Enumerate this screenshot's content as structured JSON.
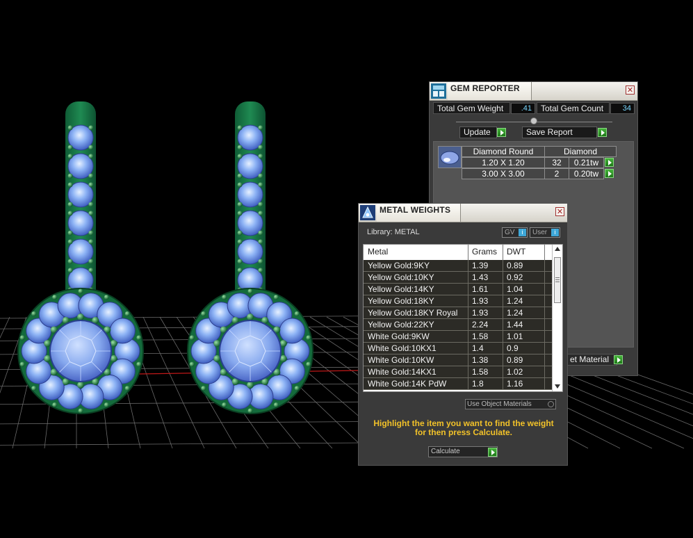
{
  "gem_reporter": {
    "title": "GEM REPORTER",
    "total_gem_weight_label": "Total Gem Weight",
    "total_gem_weight_value": ".41",
    "total_gem_count_label": "Total Gem Count",
    "total_gem_count_value": "34",
    "update_label": "Update",
    "save_report_label": "Save Report",
    "table": {
      "header_shape": "Diamond Round",
      "header_material": "Diamond",
      "rows": [
        {
          "size": "1.20 X 1.20",
          "count": "32",
          "weight": "0.21tw"
        },
        {
          "size": "3.00 X 3.00",
          "count": "2",
          "weight": "0.20tw"
        }
      ]
    },
    "object_material_label": "et Material"
  },
  "metal_weights": {
    "title": "METAL WEIGHTS",
    "library_label": "Library: METAL",
    "gv_label": "GV",
    "user_label": "User",
    "info_glyph": "i",
    "columns": [
      "Metal",
      "Grams",
      "DWT"
    ],
    "rows": [
      {
        "metal": "Yellow Gold:9KY",
        "grams": "1.39",
        "dwt": "0.89"
      },
      {
        "metal": "Yellow Gold:10KY",
        "grams": "1.43",
        "dwt": "0.92"
      },
      {
        "metal": "Yellow Gold:14KY",
        "grams": "1.61",
        "dwt": "1.04"
      },
      {
        "metal": "Yellow Gold:18KY",
        "grams": "1.93",
        "dwt": "1.24"
      },
      {
        "metal": "Yellow Gold:18KY Royal",
        "grams": "1.93",
        "dwt": "1.24"
      },
      {
        "metal": "Yellow Gold:22KY",
        "grams": "2.24",
        "dwt": "1.44"
      },
      {
        "metal": "White Gold:9KW",
        "grams": "1.58",
        "dwt": "1.01"
      },
      {
        "metal": "White Gold:10KX1",
        "grams": "1.4",
        "dwt": "0.9"
      },
      {
        "metal": "White Gold:10KW",
        "grams": "1.38",
        "dwt": "0.89"
      },
      {
        "metal": "White Gold:14KX1",
        "grams": "1.58",
        "dwt": "1.02"
      },
      {
        "metal": "White Gold:14K PdW",
        "grams": "1.8",
        "dwt": "1.16"
      }
    ],
    "use_object_materials_label": "Use Object Materials",
    "hint_line1": "Highlight the item you want to find the weight",
    "hint_line2": "for then press Calculate.",
    "calculate_label": "Calculate"
  },
  "colors": {
    "metal_green": "#1a7a4a",
    "gem_blue": "#7aa8f0",
    "accent_button_green": "#2e9a26",
    "hint_yellow": "#f2c229",
    "value_cyan": "#79d8ff"
  }
}
